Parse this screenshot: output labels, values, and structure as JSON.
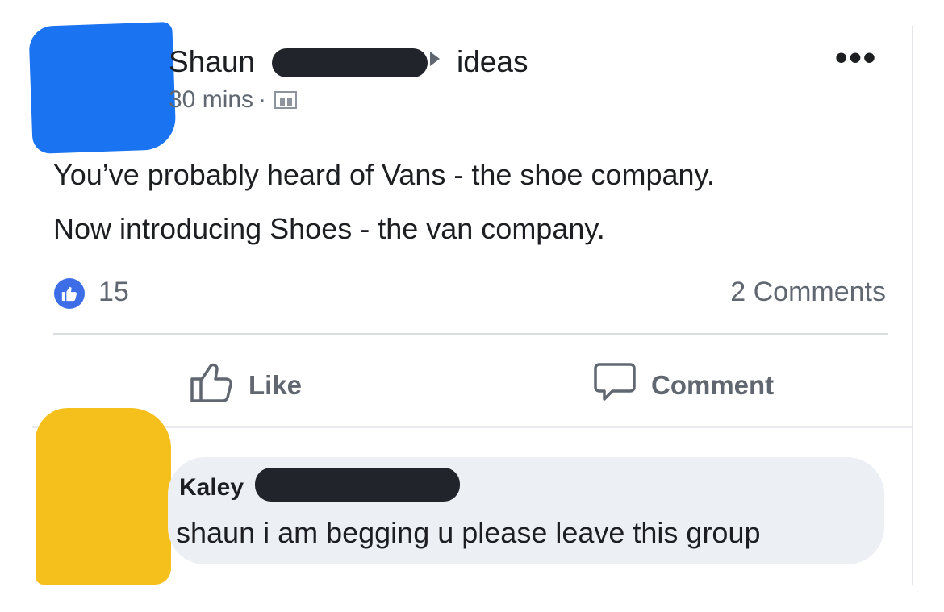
{
  "post": {
    "author_name": "Shaun",
    "group_name": "ideas",
    "time": "30 mins",
    "meta_separator": "·",
    "text_lines": [
      "You’ve probably heard of Vans - the shoe company.",
      "Now introducing Shoes - the van company."
    ],
    "like_count": "15",
    "comment_count_label": "2 Comments",
    "more_glyph": "•••"
  },
  "actions": {
    "like_label": "Like",
    "comment_label": "Comment"
  },
  "comment": {
    "author_name": "Kaley",
    "text": "shaun i am begging u please leave this group"
  },
  "icons": {
    "avatar_main": "blue-scribble-avatar",
    "avatar_comment": "yellow-scribble-avatar",
    "group_arrow": "triangle-right-icon",
    "privacy": "members-icon",
    "reaction": "thumbs-up-icon",
    "more": "more-options-icon",
    "like": "thumbs-up-outline-icon",
    "comment": "speech-bubble-icon"
  },
  "colors": {
    "avatar_main": "#1a73f0",
    "avatar_comment": "#f6c01c",
    "reaction_blue": "#3d6ee8",
    "redaction": "#22242b",
    "secondary_text": "#606770"
  }
}
